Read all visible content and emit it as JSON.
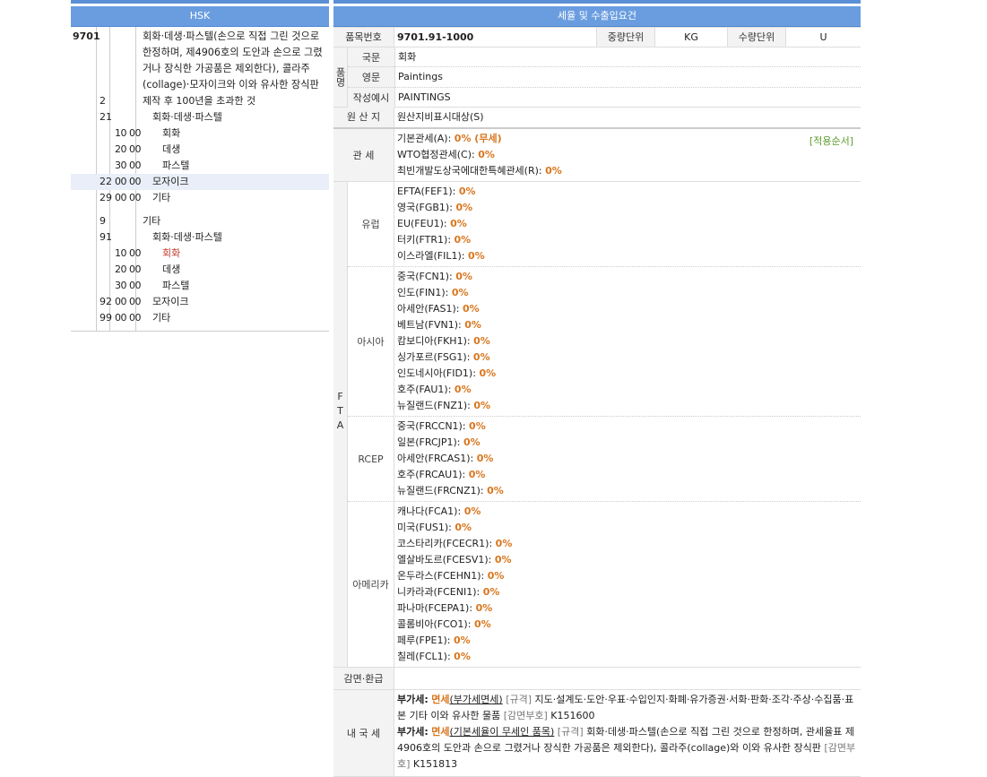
{
  "left_panel": {
    "title": "HSK",
    "heading": {
      "code": "9701",
      "description": "회화·데생·파스텔(손으로 직접 그린 것으로 한정하며, 제4906호의 도안과 손으로 그렸거나 장식한 가공품은 제외한다), 콜라주(collage)·모자이크와 이와 유사한 장식판"
    },
    "rows": [
      {
        "c2": "2",
        "c3": "",
        "desc": "제작 후 100년을 초과한 것",
        "indent": 0
      },
      {
        "c2": "21",
        "c3": "",
        "desc": "회화·데생·파스텔",
        "indent": 1
      },
      {
        "c2": "",
        "c3": "10 00",
        "desc": "회화",
        "indent": 2
      },
      {
        "c2": "",
        "c3": "20 00",
        "desc": "데생",
        "indent": 2
      },
      {
        "c2": "",
        "c3": "30 00",
        "desc": "파스텔",
        "indent": 2
      },
      {
        "c2": "22",
        "c3": "00 00",
        "desc": "모자이크",
        "indent": 1,
        "selected": true
      },
      {
        "c2": "29",
        "c3": "00 00",
        "desc": "기타",
        "indent": 1
      },
      {
        "c2": "9",
        "c3": "",
        "desc": "기타",
        "indent": 0,
        "gap": true
      },
      {
        "c2": "91",
        "c3": "",
        "desc": "회화·데생·파스텔",
        "indent": 1
      },
      {
        "c2": "",
        "c3": "10 00",
        "desc": "회화",
        "indent": 2,
        "red": true
      },
      {
        "c2": "",
        "c3": "20 00",
        "desc": "데생",
        "indent": 2
      },
      {
        "c2": "",
        "c3": "30 00",
        "desc": "파스텔",
        "indent": 2
      },
      {
        "c2": "92",
        "c3": "00 00",
        "desc": "모자이크",
        "indent": 1
      },
      {
        "c2": "99",
        "c3": "00 00",
        "desc": "기타",
        "indent": 1
      }
    ]
  },
  "right_panel": {
    "title": "세율 및 수출입요건",
    "item_no_label": "품목번호",
    "item_no": "9701.91-1000",
    "weight_unit_label": "중량단위",
    "weight_unit": "KG",
    "qty_unit_label": "수량단위",
    "qty_unit": "U",
    "name_group_label": "품명",
    "name_rows": [
      {
        "label": "국문",
        "value": "회화"
      },
      {
        "label": "영문",
        "value": "Paintings"
      },
      {
        "label": "작성예시",
        "value": "PAINTINGS"
      }
    ],
    "origin_label": "원 산 지",
    "origin_value": "원산지비표시대상(S)",
    "tariff_label": "관 세",
    "tariff_order_link": "[적용순서]",
    "tariffs": [
      {
        "name": "기본관세(A):",
        "rate": "0% (무세)"
      },
      {
        "name": "WTO협정관세(C):",
        "rate": "0%"
      },
      {
        "name": "최빈개발도상국에대한특혜관세(R):",
        "rate": "0%"
      }
    ],
    "fta_label": "F T A",
    "fta_groups": [
      {
        "region": "유럽",
        "items": [
          {
            "name": "EFTA(FEF1):",
            "rate": "0%"
          },
          {
            "name": "영국(FGB1):",
            "rate": "0%"
          },
          {
            "name": "EU(FEU1):",
            "rate": "0%"
          },
          {
            "name": "터키(FTR1):",
            "rate": "0%"
          },
          {
            "name": "이스라엘(FIL1):",
            "rate": "0%"
          }
        ]
      },
      {
        "region": "아시아",
        "items": [
          {
            "name": "중국(FCN1):",
            "rate": "0%"
          },
          {
            "name": "인도(FIN1):",
            "rate": "0%"
          },
          {
            "name": "아세안(FAS1):",
            "rate": "0%"
          },
          {
            "name": "베트남(FVN1):",
            "rate": "0%"
          },
          {
            "name": "캄보디아(FKH1):",
            "rate": "0%"
          },
          {
            "name": "싱가포르(FSG1):",
            "rate": "0%"
          },
          {
            "name": "인도네시아(FID1):",
            "rate": "0%"
          },
          {
            "name": "호주(FAU1):",
            "rate": "0%"
          },
          {
            "name": "뉴질랜드(FNZ1):",
            "rate": "0%"
          }
        ]
      },
      {
        "region": "RCEP",
        "items": [
          {
            "name": "중국(FRCCN1):",
            "rate": "0%"
          },
          {
            "name": "일본(FRCJP1):",
            "rate": "0%"
          },
          {
            "name": "아세안(FRCAS1):",
            "rate": "0%"
          },
          {
            "name": "호주(FRCAU1):",
            "rate": "0%"
          },
          {
            "name": "뉴질랜드(FRCNZ1):",
            "rate": "0%"
          }
        ]
      },
      {
        "region": "아메리카",
        "items": [
          {
            "name": "캐나다(FCA1):",
            "rate": "0%"
          },
          {
            "name": "미국(FUS1):",
            "rate": "0%"
          },
          {
            "name": "코스타리카(FCECR1):",
            "rate": "0%"
          },
          {
            "name": "엘살바도르(FCESV1):",
            "rate": "0%"
          },
          {
            "name": "온두라스(FCEHN1):",
            "rate": "0%"
          },
          {
            "name": "니카라과(FCENI1):",
            "rate": "0%"
          },
          {
            "name": "파나마(FCEPA1):",
            "rate": "0%"
          },
          {
            "name": "콜롬비아(FCO1):",
            "rate": "0%"
          },
          {
            "name": "페루(FPE1):",
            "rate": "0%"
          },
          {
            "name": "칠레(FCL1):",
            "rate": "0%"
          }
        ]
      }
    ],
    "reduction_label": "감면·환급",
    "domestic_label": "내 국 세",
    "domestic": [
      {
        "tax": "부가세:",
        "status": "면세",
        "link": "(부가세면세)",
        "spec_tag": "[규격]",
        "spec": "지도·설계도·도안·우표·수입인지·화폐·유가증권·서화·판화·조각·주상·수집품·표본 기타 이와 유사한 물품",
        "code_tag": "[감면부호]",
        "code": "K151600"
      },
      {
        "tax": "부가세:",
        "status": "면세",
        "link": "(기본세율이 무세인 품목)",
        "spec_tag": "[규격]",
        "spec": "회화·데생·파스텔(손으로 직접 그린 것으로 한정하며, 관세율표 제4906호의 도안과 손으로 그렸거나 장식한 가공품은 제외한다), 콜라주(collage)와 이와 유사한 장식판",
        "code_tag": "[감면부호]",
        "code": "K151813"
      }
    ]
  }
}
